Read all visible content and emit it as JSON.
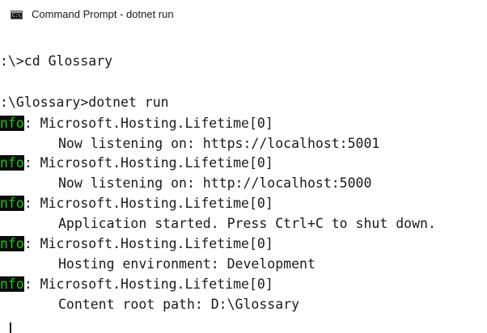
{
  "window": {
    "title": "Command Prompt - dotnet  run",
    "icon": "command-prompt-icon",
    "icon_glyph": "C:\\"
  },
  "console": {
    "prompt1": ":\\>cd Glossary",
    "prompt2": ":\\Glossary>dotnet run",
    "log_badge": "nfo",
    "log_badge_colors": {
      "foreground": "#16c60c",
      "background": "#0c0c0c"
    },
    "entries": [
      {
        "category": ": Microsoft.Hosting.Lifetime[0]",
        "message": "Now listening on: https://localhost:5001"
      },
      {
        "category": ": Microsoft.Hosting.Lifetime[0]",
        "message": "Now listening on: http://localhost:5000"
      },
      {
        "category": ": Microsoft.Hosting.Lifetime[0]",
        "message": "Application started. Press Ctrl+C to shut down."
      },
      {
        "category": ": Microsoft.Hosting.Lifetime[0]",
        "message": "Hosting environment: Development"
      },
      {
        "category": ": Microsoft.Hosting.Lifetime[0]",
        "message": "Content root path: D:\\Glossary"
      }
    ]
  }
}
